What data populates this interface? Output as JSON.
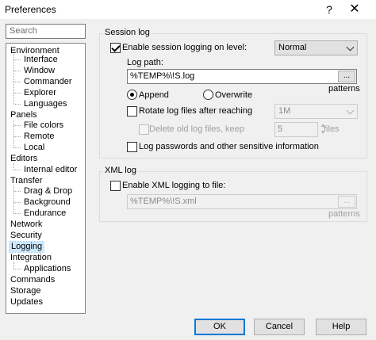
{
  "window": {
    "title": "Preferences",
    "help_glyph": "?",
    "close_glyph": "✕"
  },
  "search": {
    "placeholder": "Search"
  },
  "tree": [
    {
      "label": "Environment"
    },
    {
      "label": "Interface"
    },
    {
      "label": "Window"
    },
    {
      "label": "Commander"
    },
    {
      "label": "Explorer"
    },
    {
      "label": "Languages"
    },
    {
      "label": "Panels"
    },
    {
      "label": "File colors"
    },
    {
      "label": "Remote"
    },
    {
      "label": "Local"
    },
    {
      "label": "Editors"
    },
    {
      "label": "Internal editor"
    },
    {
      "label": "Transfer"
    },
    {
      "label": "Drag & Drop"
    },
    {
      "label": "Background"
    },
    {
      "label": "Endurance"
    },
    {
      "label": "Network"
    },
    {
      "label": "Security"
    },
    {
      "label": "Logging"
    },
    {
      "label": "Integration"
    },
    {
      "label": "Applications"
    },
    {
      "label": "Commands"
    },
    {
      "label": "Storage"
    },
    {
      "label": "Updates"
    }
  ],
  "session_log": {
    "legend": "Session log",
    "enable_label": "Enable session logging on level:",
    "level": "Normal",
    "log_path_label": "Log path:",
    "log_path": "%TEMP%\\!S.log",
    "browse_label": "...",
    "patterns_label": "patterns",
    "append_label": "Append",
    "overwrite_label": "Overwrite",
    "rotate_label": "Rotate log files after reaching",
    "rotate_size": "1M",
    "delete_old_label": "Delete old log files, keep",
    "keep_count": "5",
    "files_label": "files",
    "passwords_label": "Log passwords and other sensitive information"
  },
  "xml_log": {
    "legend": "XML log",
    "enable_label": "Enable XML logging to file:",
    "path": "%TEMP%\\!S.xml",
    "browse_label": "...",
    "patterns_label": "patterns"
  },
  "buttons": {
    "ok": "OK",
    "cancel": "Cancel",
    "help": "Help"
  },
  "colors": {
    "selection": "#cce8ff",
    "default_button_border": "#0078d7"
  }
}
